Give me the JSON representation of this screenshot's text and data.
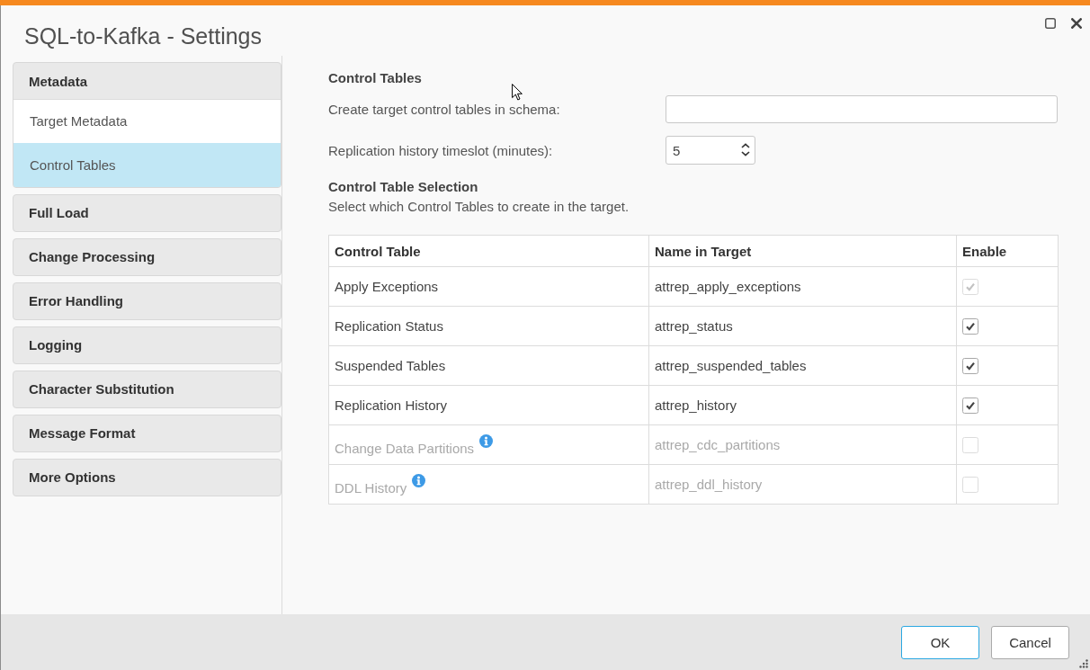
{
  "window": {
    "title": "SQL-to-Kafka - Settings"
  },
  "sidebar": {
    "groups": [
      {
        "label": "Metadata",
        "children": [
          {
            "label": "Target Metadata",
            "selected": false
          },
          {
            "label": "Control Tables",
            "selected": true
          }
        ]
      },
      {
        "label": "Full Load"
      },
      {
        "label": "Change Processing"
      },
      {
        "label": "Error Handling"
      },
      {
        "label": "Logging"
      },
      {
        "label": "Character Substitution"
      },
      {
        "label": "Message Format"
      },
      {
        "label": "More Options"
      }
    ]
  },
  "content": {
    "title": "Control Tables",
    "schema_field": {
      "label": "Create target control tables in schema:"
    },
    "timeslot_field": {
      "label": "Replication history timeslot (minutes):",
      "value": "5"
    },
    "selection": {
      "title": "Control Table Selection",
      "description": "Select which Control Tables to create in the target.",
      "table": {
        "columns": [
          "Control Table",
          "Name in Target",
          "Enable"
        ],
        "rows": [
          {
            "control_table": "Apply Exceptions",
            "name_in_target": "attrep_apply_exceptions",
            "disabled": false,
            "info": false,
            "enable": {
              "checked": true,
              "disabled": true
            }
          },
          {
            "control_table": "Replication Status",
            "name_in_target": "attrep_status",
            "disabled": false,
            "info": false,
            "enable": {
              "checked": true,
              "disabled": false
            }
          },
          {
            "control_table": "Suspended Tables",
            "name_in_target": "attrep_suspended_tables",
            "disabled": false,
            "info": false,
            "enable": {
              "checked": true,
              "disabled": false
            }
          },
          {
            "control_table": "Replication History",
            "name_in_target": "attrep_history",
            "disabled": false,
            "info": false,
            "enable": {
              "checked": true,
              "disabled": false
            }
          },
          {
            "control_table": "Change Data Partitions",
            "name_in_target": "attrep_cdc_partitions",
            "disabled": true,
            "info": true,
            "enable": {
              "checked": false,
              "disabled": true
            }
          },
          {
            "control_table": "DDL History",
            "name_in_target": "attrep_ddl_history",
            "disabled": true,
            "info": true,
            "enable": {
              "checked": false,
              "disabled": true
            }
          }
        ]
      }
    }
  },
  "buttons": [
    {
      "label": "OK",
      "kind": "primary"
    },
    {
      "label": "Cancel",
      "kind": "secondary"
    }
  ]
}
